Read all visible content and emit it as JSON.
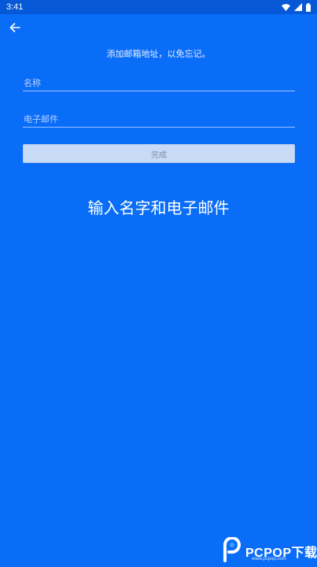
{
  "status_bar": {
    "time": "3:41",
    "icons": [
      "wifi-icon",
      "signal-icon",
      "battery-icon"
    ]
  },
  "header": {
    "back_icon": "arrow-left-icon"
  },
  "form": {
    "hint": "添加邮箱地址，以免忘记。",
    "name_placeholder": "名称",
    "email_placeholder": "电子邮件",
    "done_label": "完成"
  },
  "caption": "输入名字和电子邮件",
  "watermark": {
    "brand": "PCPOP下载",
    "url": "www.pcpop.com"
  },
  "colors": {
    "background": "#0a6df8",
    "status_bar": "#0658d6",
    "button_disabled_bg": "#c7dbf7",
    "button_disabled_text": "#7d8ea8"
  }
}
